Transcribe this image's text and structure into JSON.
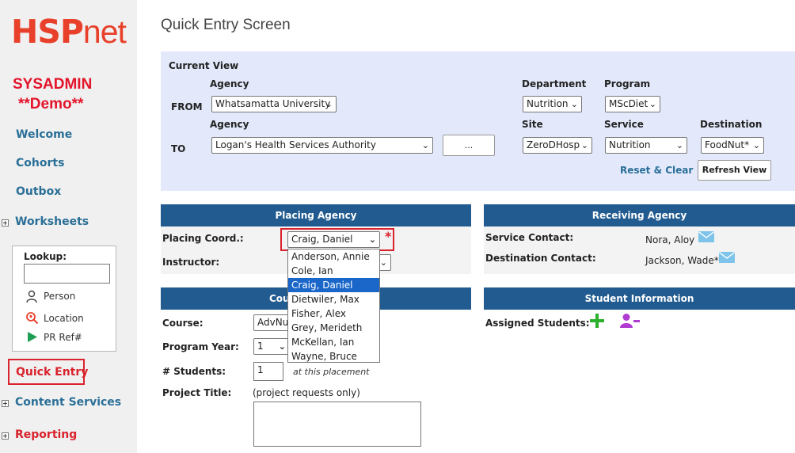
{
  "sidebar": {
    "logo_hsp": "HSP",
    "logo_net": "net",
    "user_line1": "SYSADMIN",
    "user_line2": "**Demo**",
    "nav": {
      "welcome": "Welcome",
      "cohorts": "Cohorts",
      "outbox": "Outbox",
      "worksheets": "Worksheets",
      "quick_entry": "Quick Entry",
      "content_services": "Content Services",
      "reporting": "Reporting"
    },
    "lookup": {
      "label": "Lookup:",
      "person": "Person",
      "location": "Location",
      "pr_ref": "PR Ref#"
    }
  },
  "page": {
    "title": "Quick Entry Screen"
  },
  "current_view": {
    "heading": "Current View",
    "from_label": "FROM",
    "to_label": "TO",
    "agency_label": "Agency",
    "department_label": "Department",
    "program_label": "Program",
    "site_label": "Site",
    "service_label": "Service",
    "destination_label": "Destination",
    "from_agency": "Whatsamatta University",
    "department": "Nutrition",
    "program": "MScDiet",
    "to_agency": "Logan's Health Services Authority",
    "ellipsis_button": "...",
    "site": "ZeroDHosp",
    "service": "Nutrition",
    "destination": "FoodNut*",
    "reset_clear": "Reset & Clear",
    "refresh_view": "Refresh View"
  },
  "placing_agency": {
    "heading": "Placing Agency",
    "placing_coord_label": "Placing Coord.:",
    "placing_coord_value": "Craig, Daniel",
    "required_mark": "*",
    "instructor_label": "Instructor:",
    "dropdown_options": [
      "Anderson, Annie",
      "Cole, Ian",
      "Craig, Daniel",
      "Dietwiler, Max",
      "Fisher, Alex",
      "Grey, Merideth",
      "McKellan, Ian",
      "Wayne, Bruce"
    ],
    "selected_option": "Craig, Daniel"
  },
  "course_panel": {
    "heading_visible": "Cou",
    "course_label": "Course:",
    "course_value": "AdvNu",
    "program_year_label": "Program Year:",
    "program_year_value": "1",
    "students_label": "# Students:",
    "students_value": "1",
    "students_note": "at this placement",
    "project_title_label": "Project Title:",
    "project_note": "(project requests only)"
  },
  "receiving_agency": {
    "heading": "Receiving Agency",
    "service_contact_label": "Service Contact:",
    "service_contact_value": "Nora, Aloy",
    "destination_contact_label": "Destination Contact:",
    "destination_contact_value": "Jackson, Wade*"
  },
  "student_info": {
    "heading": "Student Information",
    "assigned_label": "Assigned Students:"
  },
  "colors": {
    "brand_red": "#e8402a",
    "panel_blue": "#215b8f",
    "link_blue": "#2a6f97",
    "highlight_red": "#d9232d",
    "selected_option": "#1a66c9",
    "add_green": "#2bb12b",
    "remove_purple": "#b03bd1"
  },
  "icons": [
    "plus-box-icon",
    "person-icon",
    "location-search-icon",
    "play-arrow-icon",
    "envelope-icon",
    "add-icon",
    "remove-person-icon",
    "chevron-down-icon"
  ]
}
